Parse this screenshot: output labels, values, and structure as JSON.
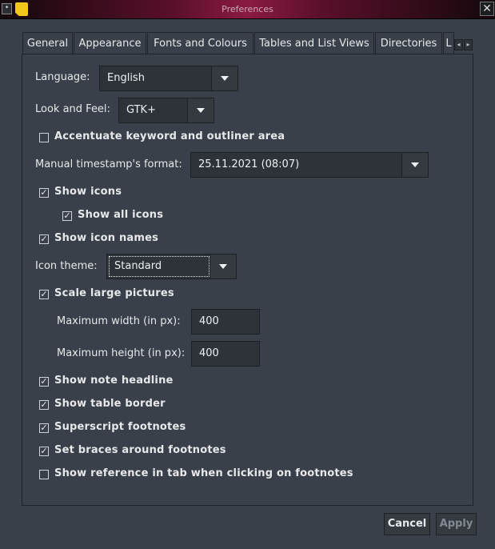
{
  "window": {
    "title": "Preferences",
    "menu_glyph": "•",
    "close_glyph": "✕"
  },
  "tabs": [
    {
      "label": "General"
    },
    {
      "label": "Appearance"
    },
    {
      "label": "Fonts and Colours"
    },
    {
      "label": "Tables and List Views"
    },
    {
      "label": "Directories"
    },
    {
      "label": "L"
    }
  ],
  "tab_scroll": {
    "left": "◂",
    "right": "▸"
  },
  "appearance": {
    "language": {
      "label": "Language:",
      "value": "English"
    },
    "look_and_feel": {
      "label": "Look and Feel:",
      "value": "GTK+"
    },
    "accentuate": {
      "label": "Accentuate keyword and outliner area",
      "checked": false
    },
    "timestamp": {
      "label": "Manual timestamp's format:",
      "value": "25.11.2021 (08:07)"
    },
    "show_icons": {
      "label": "Show icons",
      "checked": true
    },
    "show_all_icons": {
      "label": "Show all icons",
      "checked": true
    },
    "show_icon_names": {
      "label": "Show icon names",
      "checked": true
    },
    "icon_theme": {
      "label": "Icon theme:",
      "value": "Standard"
    },
    "scale_pictures": {
      "label": "Scale large pictures",
      "checked": true
    },
    "max_width": {
      "label": "Maximum width (in px):",
      "value": "400"
    },
    "max_height": {
      "label": "Maximum height (in px):",
      "value": "400"
    },
    "show_note_headline": {
      "label": "Show note headline",
      "checked": true
    },
    "show_table_border": {
      "label": "Show table border",
      "checked": true
    },
    "superscript_footnotes": {
      "label": "Superscript footnotes",
      "checked": true
    },
    "braces_footnotes": {
      "label": "Set braces around footnotes",
      "checked": true
    },
    "show_reference": {
      "label": "Show reference in tab when clicking on footnotes",
      "checked": false
    }
  },
  "check_glyph": "✓",
  "buttons": {
    "cancel": "Cancel",
    "apply": "Apply"
  },
  "colors": {
    "titlebar_accent": "#8a1a44",
    "background": "#3a4049",
    "app_icon": "#f3c61a"
  }
}
